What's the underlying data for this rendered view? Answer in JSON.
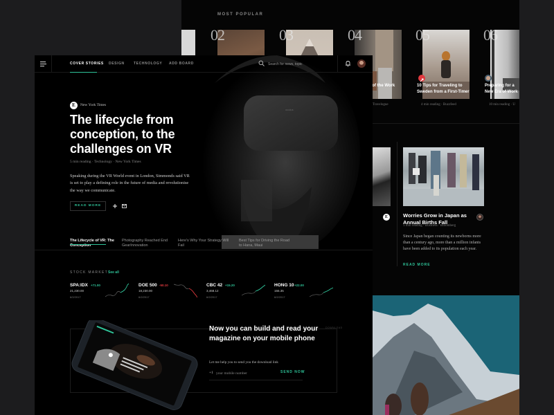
{
  "most_popular": {
    "label": "MOST POPULAR",
    "items": [
      {
        "num": "02"
      },
      {
        "num": "03"
      },
      {
        "num": "04",
        "title": "Secrets of the Work",
        "meta": "Travelogue"
      },
      {
        "num": "05",
        "title": "10 Tips for Traveling to Sweden from a First-Timer",
        "meta": "4 min reading  ·  Buzzfeed"
      },
      {
        "num": "06",
        "title": "Preparing for a New Era of Work",
        "meta": "10 min reading  ·  U"
      }
    ]
  },
  "side_article": {
    "title": "Worries Grow in Japan as Annual Births Fall",
    "meta": "1 min reading  ·  Business  ·  Bloomberg",
    "body": "Since Japan began counting its newborns more than a century ago, more than a million infants have been added to its population each year.",
    "read_more": "READ MORE",
    "left_logo": "E"
  },
  "nav": {
    "items": [
      "COVER STORIES",
      "DESIGN",
      "TECHNOLOGY",
      "ADD BOARD"
    ],
    "active": "COVER STORIES",
    "search_placeholder": "Search for news, topic"
  },
  "hero": {
    "source_logo": "E",
    "source": "New York Times",
    "title": "The lifecycle from conception, to the challenges on VR",
    "meta": "5 min reading  ·  Technology  ·  New York Times",
    "body": "Speaking during the VR World event in London, Simmonds said VR is set to play a defining role in the future of media and revolutionise the way we communicate.",
    "read_more": "READ MORE"
  },
  "story_tabs": [
    "The Lifecycle of VR: The Conception",
    "Photography Reached End GearInnovation",
    "Here's Why Your Strategy Will Fail",
    "Best Tips for Driving the Road to Hana, Maui"
  ],
  "stock_market": {
    "label": "STOCK MARKET",
    "see_all": "See all",
    "colors": {
      "up": "#2fc59a",
      "down": "#e0393e"
    },
    "stocks": [
      {
        "symbol": "SPA:IDX",
        "change": "+71.00",
        "value": "21,230.00",
        "date": "6/2/2017",
        "trend": "up"
      },
      {
        "symbol": "DOE 500",
        "change": "-50.10",
        "value": "18,230.00",
        "date": "6/2/2017",
        "trend": "down"
      },
      {
        "symbol": "CBC 42",
        "change": "+15.20",
        "value": "3,468.12",
        "date": "6/2/2017",
        "trend": "up"
      },
      {
        "symbol": "HONG 10",
        "change": "+22.00",
        "value": "155.35",
        "date": "6/2/2017",
        "trend": "up"
      }
    ]
  },
  "promo": {
    "title": "Now you can build and read your magazine on your mobile phone",
    "subtitle": "Let me help you to send you the download link",
    "prefix": "+1",
    "phone_placeholder": "your mobile number",
    "send": "SEND NOW",
    "tag": "DOWNLOAD"
  },
  "accent_color": "#2fc59a"
}
